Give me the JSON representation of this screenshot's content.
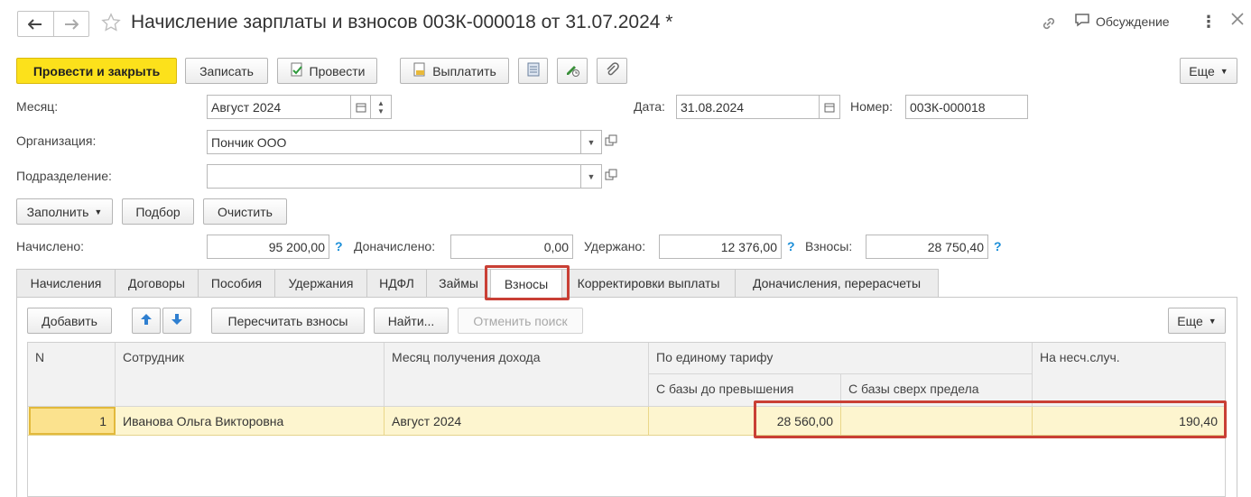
{
  "window": {
    "title": "Начисление зарплаты и взносов 00ЗК-000018 от 31.07.2024 *",
    "discussion_label": "Обсуждение"
  },
  "toolbar": {
    "post_close_label": "Провести и закрыть",
    "save_label": "Записать",
    "post_label": "Провести",
    "pay_label": "Выплатить",
    "more_label": "Еще"
  },
  "form": {
    "month_label": "Месяц:",
    "month_value": "Август 2024",
    "date_label": "Дата:",
    "date_value": "31.08.2024",
    "number_label": "Номер:",
    "number_value": "00ЗК-000018",
    "org_label": "Организация:",
    "org_value": "Пончик ООО",
    "dept_label": "Подразделение:",
    "dept_value": ""
  },
  "actions": {
    "fill_label": "Заполнить",
    "select_label": "Подбор",
    "clear_label": "Очистить"
  },
  "totals": {
    "accrued_label": "Начислено:",
    "accrued_value": "95 200,00",
    "additional_label": "Доначислено:",
    "additional_value": "0,00",
    "withheld_label": "Удержано:",
    "withheld_value": "12 376,00",
    "contributions_label": "Взносы:",
    "contributions_value": "28 750,40",
    "help_mark": "?"
  },
  "tabs": [
    {
      "label": "Начисления"
    },
    {
      "label": "Договоры"
    },
    {
      "label": "Пособия"
    },
    {
      "label": "Удержания"
    },
    {
      "label": "НДФЛ"
    },
    {
      "label": "Займы"
    },
    {
      "label": "Взносы",
      "active": true
    },
    {
      "label": "Корректировки выплаты"
    },
    {
      "label": "Доначисления, перерасчеты"
    }
  ],
  "tab_toolbar": {
    "add_label": "Добавить",
    "recalc_label": "Пересчитать взносы",
    "find_label": "Найти...",
    "cancel_search_label": "Отменить поиск",
    "more_label": "Еще"
  },
  "table": {
    "headers": {
      "n": "N",
      "employee": "Сотрудник",
      "income_month": "Месяц получения дохода",
      "single_tariff": "По единому тарифу",
      "base_below": "С базы до превышения",
      "base_above": "С базы сверх предела",
      "accident": "На несч.случ."
    },
    "rows": [
      {
        "n": "1",
        "employee": "Иванова Ольга Викторовна",
        "income_month": "Август 2024",
        "base_below": "28 560,00",
        "base_above": "",
        "accident": "190,40"
      }
    ]
  },
  "colors": {
    "primary_button": "#fce11b",
    "highlight_box": "#c93f35",
    "selected_row": "#fdf5cf",
    "help_mark": "#1a8ed8"
  }
}
